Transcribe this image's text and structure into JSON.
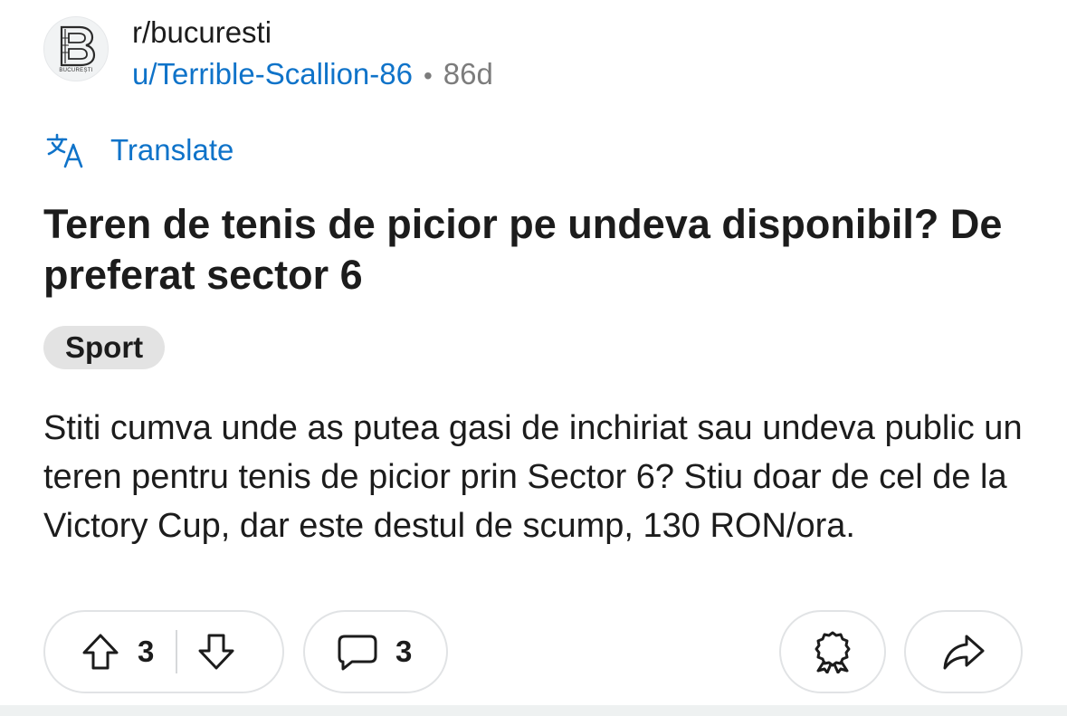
{
  "post": {
    "subreddit": "r/bucuresti",
    "avatar_caption": "BUCUREȘTI",
    "author": "u/Terrible-Scallion-86",
    "separator": "•",
    "age": "86d",
    "translate_label": "Translate",
    "title": "Teren de tenis de picior pe undeva disponibil? De preferat sector 6",
    "flair": "Sport",
    "body": "Stiti cumva unde as putea gasi de inchiriat sau undeva public un teren pentru tenis de picior prin Sector 6? Stiu doar de cel de la Victory Cup, dar este destul de scump, 130 RON/ora."
  },
  "actions": {
    "vote_count": "3",
    "comment_count": "3"
  },
  "icons": {
    "translate": "translate-icon",
    "upvote": "upvote-arrow-icon",
    "downvote": "downvote-arrow-icon",
    "comment": "comment-bubble-icon",
    "award": "award-ribbon-icon",
    "share": "share-arrow-icon"
  },
  "colors": {
    "link": "#0f73c9",
    "text": "#1c1c1c",
    "muted": "#7c7c7c",
    "flair_bg": "#e3e3e3",
    "pill_border": "#e1e3e5"
  }
}
